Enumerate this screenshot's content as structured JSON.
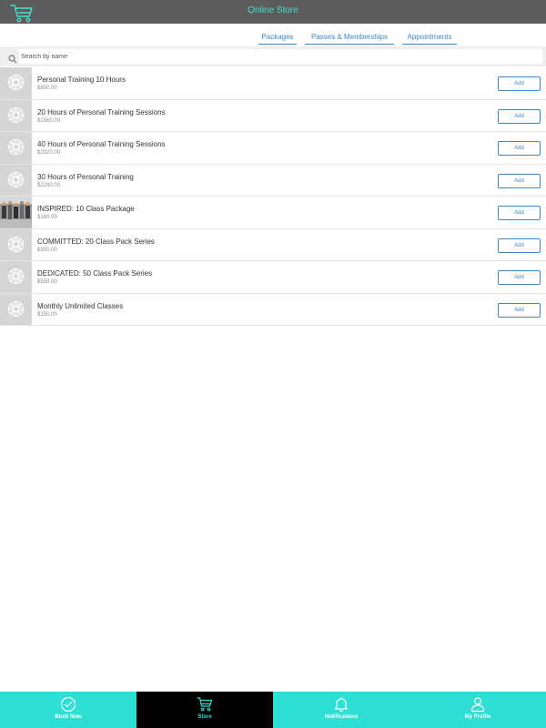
{
  "header": {
    "title": "Online Store",
    "accent_color": "#3de2d3",
    "background_color": "#5c5c5c"
  },
  "tabs": [
    {
      "label": "Packages"
    },
    {
      "label": "Passes & Memberships"
    },
    {
      "label": "Appointments"
    }
  ],
  "search": {
    "placeholder": "Search by name",
    "value": ""
  },
  "products": [
    {
      "name": "Personal Training 10 Hours",
      "price": "$800.00",
      "icon": "flower-placeholder-icon",
      "add_label": "Add"
    },
    {
      "name": "20 Hours of Personal Training Sessions",
      "price": "$1560.00",
      "icon": "flower-placeholder-icon",
      "add_label": "Add"
    },
    {
      "name": "40 Hours of Personal Training Sessions",
      "price": "$2920.00",
      "icon": "flower-placeholder-icon",
      "add_label": "Add"
    },
    {
      "name": "30 Hours of Personal Training",
      "price": "$2280.00",
      "icon": "flower-placeholder-icon",
      "add_label": "Add"
    },
    {
      "name": "INSPIRED: 10 Class Package",
      "price": "$180.00",
      "icon": "class-photo",
      "add_label": "Add"
    },
    {
      "name": "COMMITTED: 20 Class Pack Series",
      "price": "$300.00",
      "icon": "flower-placeholder-icon",
      "add_label": "Add"
    },
    {
      "name": "DEDICATED: 50 Class Pack Series",
      "price": "$550.00",
      "icon": "flower-placeholder-icon",
      "add_label": "Add"
    },
    {
      "name": "Monthly Unlimited Classes",
      "price": "$150.00",
      "icon": "flower-placeholder-icon",
      "add_label": "Add"
    }
  ],
  "bottom_nav": {
    "active_index": 1,
    "active_color": "#000000",
    "bar_color": "#2ee0d3",
    "items": [
      {
        "label": "Book Now",
        "icon": "check-circle-icon"
      },
      {
        "label": "Store",
        "icon": "cart-icon"
      },
      {
        "label": "Notifications",
        "icon": "bell-icon"
      },
      {
        "label": "My Profile",
        "icon": "user-icon"
      }
    ]
  }
}
